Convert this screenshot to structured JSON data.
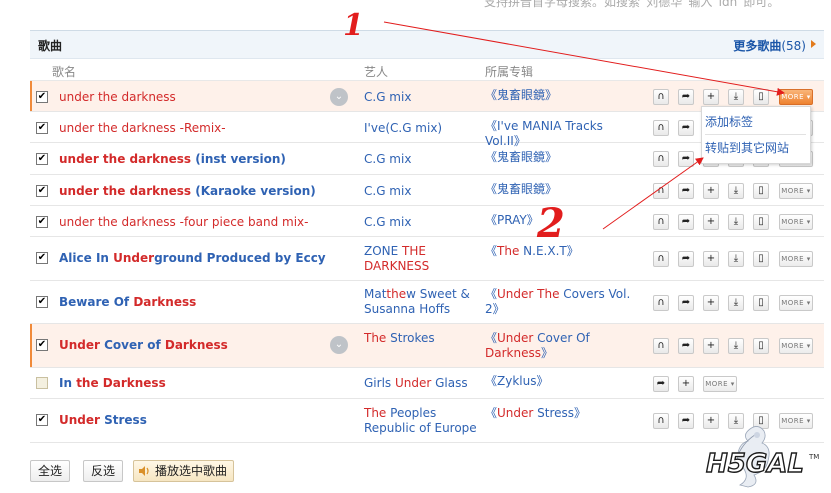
{
  "top_hint": "支持拼音首字母搜索。如搜索“刘德华”输入“ldh”即可。",
  "section": {
    "title": "歌曲",
    "more_label": "更多歌曲",
    "more_count": "(58)"
  },
  "columns": {
    "song": "歌名",
    "artist": "艺人",
    "album": "所属专辑"
  },
  "rows": [
    {
      "checked": true,
      "song": [
        {
          "t": "under the darkness",
          "c": "red"
        }
      ],
      "artist": [
        {
          "t": "C.G mix",
          "c": "blue"
        }
      ],
      "album": [
        {
          "t": "《鬼畜眼鏡》",
          "c": "blue"
        }
      ],
      "highlight": true,
      "icon": true,
      "actions": "full",
      "more_active": true
    },
    {
      "checked": true,
      "song": [
        {
          "t": "under the darkness -Remix-",
          "c": "red"
        }
      ],
      "artist": [
        {
          "t": "I've(C.G mix)",
          "c": "blue"
        }
      ],
      "album": [
        {
          "t": "《I've MANIA Tracks Vol.II》",
          "c": "blue"
        }
      ],
      "actions": "full"
    },
    {
      "checked": true,
      "song": [
        {
          "t": "under the darkness ",
          "c": "red"
        },
        {
          "t": "(inst version)",
          "c": "blue"
        }
      ],
      "artist": [
        {
          "t": "C.G mix",
          "c": "blue"
        }
      ],
      "album": [
        {
          "t": "《鬼畜眼鏡》",
          "c": "blue"
        }
      ],
      "actions": "full"
    },
    {
      "checked": true,
      "song": [
        {
          "t": "under the darkness ",
          "c": "red"
        },
        {
          "t": "(Karaoke version)",
          "c": "blue"
        }
      ],
      "artist": [
        {
          "t": "C.G mix",
          "c": "blue"
        }
      ],
      "album": [
        {
          "t": "《鬼畜眼鏡》",
          "c": "blue"
        }
      ],
      "actions": "full"
    },
    {
      "checked": true,
      "song": [
        {
          "t": "under the darkness -four piece band mix-",
          "c": "red"
        }
      ],
      "artist": [
        {
          "t": "C.G mix",
          "c": "blue"
        }
      ],
      "album": [
        {
          "t": "《PRAY》",
          "c": "blue"
        }
      ],
      "actions": "full"
    },
    {
      "checked": true,
      "song": [
        {
          "t": "Alice In ",
          "c": "blue"
        },
        {
          "t": "Under",
          "c": "red"
        },
        {
          "t": "ground Produced by Eccy",
          "c": "blue"
        }
      ],
      "artist": [
        {
          "t": "ZONE ",
          "c": "blue"
        },
        {
          "t": "THE DARKNESS",
          "c": "red"
        }
      ],
      "album": [
        {
          "t": "《",
          "c": "blue"
        },
        {
          "t": "The",
          "c": "red"
        },
        {
          "t": " N.E.X.T》",
          "c": "blue"
        }
      ],
      "actions": "full"
    },
    {
      "checked": true,
      "song": [
        {
          "t": "Beware Of ",
          "c": "blue"
        },
        {
          "t": "Darkness",
          "c": "red"
        }
      ],
      "artist": [
        {
          "t": "Mat",
          "c": "blue"
        },
        {
          "t": "the",
          "c": "red"
        },
        {
          "t": "w Sweet & Susanna Hoffs",
          "c": "blue"
        }
      ],
      "album": [
        {
          "t": "《",
          "c": "blue"
        },
        {
          "t": "Under The",
          "c": "red"
        },
        {
          "t": " Covers Vol. 2》",
          "c": "blue"
        }
      ],
      "actions": "full"
    },
    {
      "checked": true,
      "song": [
        {
          "t": "Under ",
          "c": "red"
        },
        {
          "t": "Cover of ",
          "c": "blue"
        },
        {
          "t": "Darkness",
          "c": "red"
        }
      ],
      "artist": [
        {
          "t": "The",
          "c": "red"
        },
        {
          "t": " Strokes",
          "c": "blue"
        }
      ],
      "album": [
        {
          "t": "《",
          "c": "blue"
        },
        {
          "t": "Under",
          "c": "red"
        },
        {
          "t": " Cover Of ",
          "c": "blue"
        },
        {
          "t": "Darkness",
          "c": "red"
        },
        {
          "t": "》",
          "c": "blue"
        }
      ],
      "highlight": true,
      "icon": true,
      "actions": "full"
    },
    {
      "checked": false,
      "song": [
        {
          "t": "In ",
          "c": "blue"
        },
        {
          "t": "the Darkness",
          "c": "red"
        }
      ],
      "artist": [
        {
          "t": "Girls ",
          "c": "blue"
        },
        {
          "t": "Under",
          "c": "red"
        },
        {
          "t": " Glass",
          "c": "blue"
        }
      ],
      "album": [
        {
          "t": "《Zyklus》",
          "c": "blue"
        }
      ],
      "actions": "short"
    },
    {
      "checked": true,
      "song": [
        {
          "t": "Under ",
          "c": "red"
        },
        {
          "t": "Stress",
          "c": "blue"
        }
      ],
      "artist": [
        {
          "t": "The",
          "c": "red"
        },
        {
          "t": " Peoples Republic of Europe",
          "c": "blue"
        }
      ],
      "album": [
        {
          "t": "《",
          "c": "blue"
        },
        {
          "t": "Under",
          "c": "red"
        },
        {
          "t": " Stress》",
          "c": "blue"
        }
      ],
      "actions": "full"
    }
  ],
  "more_btn_label": "MORE",
  "dropdown": {
    "items": [
      "添加标签",
      "转贴到其它网站"
    ]
  },
  "footer": {
    "select_all": "全选",
    "invert": "反选",
    "play_selected": "播放选中歌曲"
  },
  "annotations": {
    "one": "1",
    "two": "2"
  },
  "accent_colors": {
    "match": "#d32a2a",
    "link": "#2f62b3",
    "more_active": "#ee8230",
    "arrow": "#e21d1d"
  }
}
